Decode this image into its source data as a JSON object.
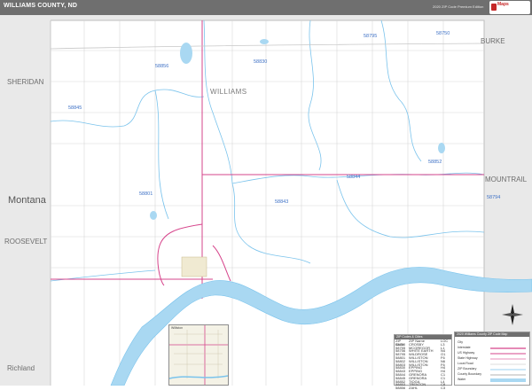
{
  "header": {
    "title": "WILLIAMS COUNTY, ND",
    "edition": "2020 ZIP Code Premium Edition",
    "logo_text": "Maps"
  },
  "colors": {
    "title_bar": "#6f6f6f",
    "outside_county": "#e9e9e9",
    "county_fill": "#ffffff",
    "water": "#a9d8f2",
    "zip_boundary": "#7ac3ec",
    "highway": "#d6448b",
    "road": "#cfcfcf"
  },
  "map": {
    "county_label": "WILLIAMS",
    "neighbors": {
      "north_west": "SHERIDAN",
      "west": "Montana",
      "south_west_1": "ROOSEVELT",
      "south_west_2": "Richland",
      "north_east": "BURKE",
      "east": "MOUNTRAIL"
    },
    "zip_labels": [
      {
        "name": "zip-58856",
        "text": "58856"
      },
      {
        "name": "zip-58830",
        "text": "58830"
      },
      {
        "name": "zip-58795",
        "text": "58795"
      },
      {
        "name": "zip-58750",
        "text": "58750"
      },
      {
        "name": "zip-58845",
        "text": "58845"
      },
      {
        "name": "zip-58852",
        "text": "58852"
      },
      {
        "name": "zip-58844",
        "text": "58844"
      },
      {
        "name": "zip-58843",
        "text": "58843"
      },
      {
        "name": "zip-58801",
        "text": "58801"
      },
      {
        "name": "zip-58794",
        "text": "58794"
      }
    ]
  },
  "zip_table": {
    "header": "ZIP Codes & Cities",
    "columns": [
      "ZIP Code",
      "ZIP Name",
      "LOC"
    ],
    "rows": [
      [
        "58730",
        "CROSBY",
        "L3"
      ],
      [
        "58755",
        "MCGREGOR",
        "L1"
      ],
      [
        "58756",
        "WHITE EARTH",
        "N4"
      ],
      [
        "58795",
        "WILDROSE",
        "O1"
      ],
      [
        "58801",
        "WILLISTON",
        "F6"
      ],
      [
        "58802",
        "WILLISTON",
        "N6"
      ],
      [
        "58803",
        "WILLISTON",
        "F6"
      ],
      [
        "58830",
        "EPPING",
        "H4"
      ],
      [
        "58843",
        "EPPING",
        "H4"
      ],
      [
        "58844",
        "GRENORA",
        "C1"
      ],
      [
        "58845",
        "GRENORA",
        "C1"
      ],
      [
        "58852",
        "TIOGA",
        "L4"
      ],
      [
        "58853",
        "TRENTON",
        "C8"
      ],
      [
        "58856",
        "ZAHL",
        "C3"
      ]
    ]
  },
  "map_legend": {
    "header": "2020 Williams County ZIP Code Map",
    "rows": [
      "City",
      "Interstate",
      "US Highway",
      "State Highway",
      "Local Road",
      "ZIP Boundary",
      "County Boundary",
      "Water"
    ]
  },
  "inset": {
    "label": "Williston"
  }
}
